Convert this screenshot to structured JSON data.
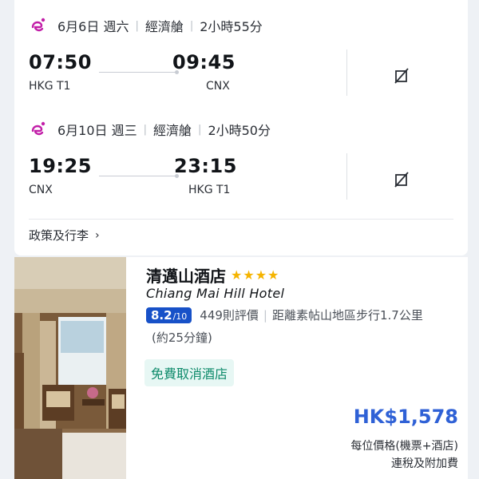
{
  "flights": [
    {
      "date": "6月6日 週六",
      "cabin": "經濟艙",
      "duration": "2小時55分",
      "depart_time": "07:50",
      "arrive_time": "09:45",
      "depart_airport": "HKG T1",
      "arrive_airport": "CNX"
    },
    {
      "date": "6月10日 週三",
      "cabin": "經濟艙",
      "duration": "2小時50分",
      "depart_time": "19:25",
      "arrive_time": "23:15",
      "depart_airport": "CNX",
      "arrive_airport": "HKG T1"
    }
  ],
  "policy_label": "政策及行李",
  "hotel": {
    "name": "清邁山酒店",
    "name_en": "Chiang Mai Hill Hotel",
    "stars": 4,
    "rating": "8.2",
    "rating_outof": "/10",
    "reviews": "449則評價",
    "distance": "距離素帖山地區步行1.7公里",
    "distance_time": "(約25分鐘)",
    "free_cancel": "免費取消酒店",
    "price": "HK$1,578",
    "price_note_1": "每位價格(機票+酒店)",
    "price_note_2": "連稅及附加費"
  },
  "colors": {
    "price": "#2f61d6",
    "rating_badge": "#1751c8",
    "star": "#f5b400",
    "free_cancel_text": "#0d8a6a",
    "free_cancel_bg": "#e7f7f4",
    "airline_logo": "#c21ea8"
  }
}
